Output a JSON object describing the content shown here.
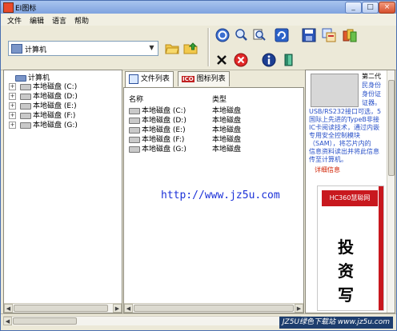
{
  "window": {
    "title": "EI图标"
  },
  "titlebar_controls": {
    "min": "_",
    "max": "□",
    "close": "×"
  },
  "menu": [
    {
      "label": "文件"
    },
    {
      "label": "编辑"
    },
    {
      "label": "语言"
    },
    {
      "label": "帮助"
    }
  ],
  "address": {
    "value": "计算机"
  },
  "toolbar_icons": {
    "open_folder": "open-folder-icon",
    "up_folder": "folder-up-icon",
    "refresh": "refresh-icon",
    "zoom_in": "zoom-in-icon",
    "zoom_out": "zoom-out-icon",
    "sync": "sync-icon",
    "save": "save-icon",
    "copy": "copy-icon",
    "extract": "extract-icon",
    "cancel": "cancel-icon",
    "stop": "stop-icon",
    "info": "info-icon",
    "exit": "exit-icon"
  },
  "tree": {
    "root": "计算机",
    "drives": [
      {
        "label": "本地磁盘 (C:)"
      },
      {
        "label": "本地磁盘 (D:)"
      },
      {
        "label": "本地磁盘 (E:)"
      },
      {
        "label": "本地磁盘 (F:)"
      },
      {
        "label": "本地磁盘 (G:)"
      }
    ]
  },
  "tabs": [
    {
      "label": "文件列表"
    },
    {
      "label": "图标列表",
      "badge": "ICO"
    }
  ],
  "list": {
    "columns": [
      "名称",
      "类型"
    ],
    "rows": [
      {
        "name": "本地磁盘 (C:)",
        "type": "本地磁盘"
      },
      {
        "name": "本地磁盘 (D:)",
        "type": "本地磁盘"
      },
      {
        "name": "本地磁盘 (E:)",
        "type": "本地磁盘"
      },
      {
        "name": "本地磁盘 (F:)",
        "type": "本地磁盘"
      },
      {
        "name": "本地磁盘 (G:)",
        "type": "本地磁盘"
      }
    ]
  },
  "ad": {
    "side_text": [
      "第二代",
      "民身份",
      "身份证",
      "证器。"
    ],
    "lines": [
      "USB/RS232接口可选，5",
      "国际上先进的TypeB非接",
      "IC卡阅读技术，通过内嵌",
      "专用安全控制模块",
      "（SAM），将芯片内的",
      "信息资料读出并将此信息",
      "传至计算机。"
    ],
    "link": "详细信息",
    "logo": "HC360慧聪网",
    "big_chars": [
      "投",
      "资",
      "写"
    ]
  },
  "watermark_url": "http://www.jz5u.com",
  "status_watermark": "JZ5U绿色下载站 www.jz5u.com"
}
